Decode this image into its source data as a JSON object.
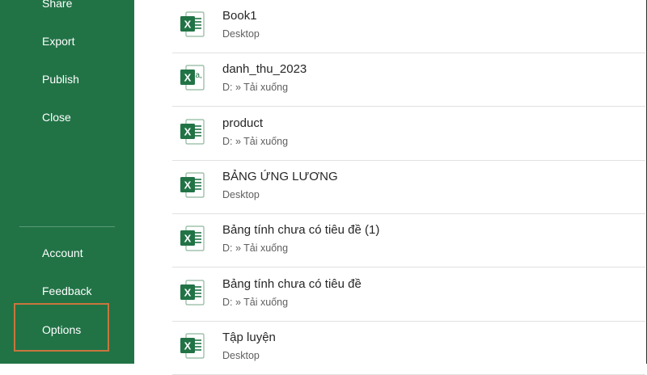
{
  "sidebar": {
    "items": [
      {
        "label": "Share"
      },
      {
        "label": "Export"
      },
      {
        "label": "Publish"
      },
      {
        "label": "Close"
      },
      {
        "label": "Account"
      },
      {
        "label": "Feedback"
      },
      {
        "label": "Options"
      }
    ],
    "highlighted_item": "Options",
    "colors": {
      "background": "#217346",
      "highlight_border": "#c8763e"
    }
  },
  "recent_files": [
    {
      "name": "Book1",
      "location": "Desktop",
      "icon": "excel-icon"
    },
    {
      "name": "danh_thu_2023",
      "location": "D: » Tải xuống",
      "icon": "excel-data-icon"
    },
    {
      "name": "product",
      "location": "D: » Tải xuống",
      "icon": "excel-icon"
    },
    {
      "name": "BẢNG ỨNG LƯƠNG",
      "location": "Desktop",
      "icon": "excel-icon"
    },
    {
      "name": "Bảng tính chưa có tiêu đề (1)",
      "location": "D: » Tải xuống",
      "icon": "excel-icon"
    },
    {
      "name": "Bảng tính chưa có tiêu đề",
      "location": "D: » Tải xuống",
      "icon": "excel-icon"
    },
    {
      "name": "Tập luyện",
      "location": "Desktop",
      "icon": "excel-icon"
    }
  ]
}
